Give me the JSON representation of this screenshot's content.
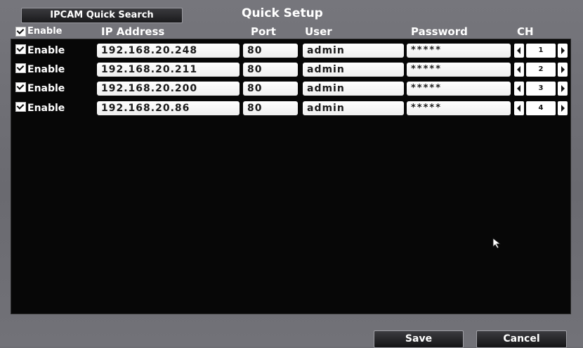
{
  "title": "Quick Setup",
  "quick_search_label": "IPCAM Quick Search",
  "headers": {
    "enable": "Enable",
    "ip_address": "IP Address",
    "port": "Port",
    "user": "User",
    "password": "Password",
    "channel": "CH"
  },
  "rows": [
    {
      "enable_label": "Enable",
      "enabled": true,
      "ip": "192.168.20.248",
      "port": "80",
      "user": "admin",
      "password": "*****",
      "channel": "1"
    },
    {
      "enable_label": "Enable",
      "enabled": true,
      "ip": "192.168.20.211",
      "port": "80",
      "user": "admin",
      "password": "*****",
      "channel": "2"
    },
    {
      "enable_label": "Enable",
      "enabled": true,
      "ip": "192.168.20.200",
      "port": "80",
      "user": "admin",
      "password": "*****",
      "channel": "3"
    },
    {
      "enable_label": "Enable",
      "enabled": true,
      "ip": "192.168.20.86",
      "port": "80",
      "user": "admin",
      "password": "*****",
      "channel": "4"
    }
  ],
  "buttons": {
    "save": "Save",
    "cancel": "Cancel"
  },
  "icons": {
    "checkbox": "checkbox-checked-icon",
    "ch_prev": "chevron-left-icon",
    "ch_next": "chevron-right-icon",
    "cursor": "mouse-pointer-icon"
  },
  "colors": {
    "background": "#6e6e74",
    "panel": "#070707",
    "field": "#ffffff",
    "button": "#1e1e20"
  }
}
